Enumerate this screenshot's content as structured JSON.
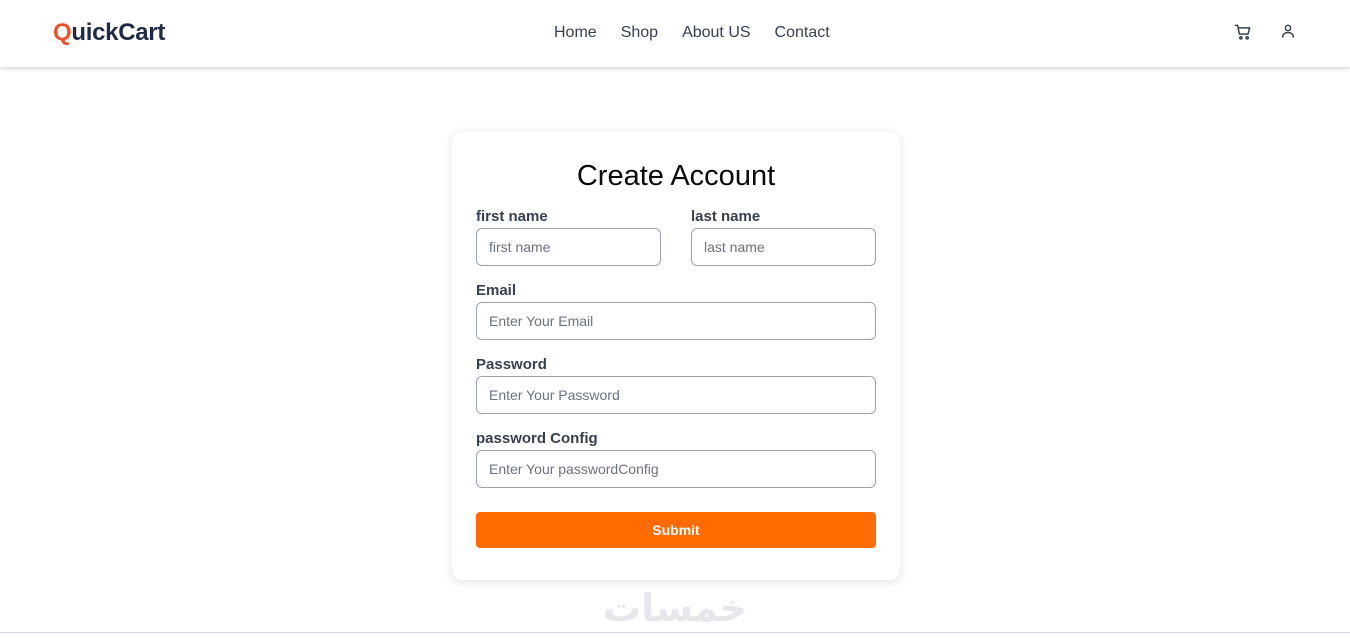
{
  "brand": {
    "first_letter": "Q",
    "rest": "uickCart",
    "accent_color": "#f0512a"
  },
  "nav": {
    "links": [
      {
        "label": "Home"
      },
      {
        "label": "Shop"
      },
      {
        "label": "About US"
      },
      {
        "label": "Contact"
      }
    ],
    "icons": [
      "cart-icon",
      "user-icon"
    ]
  },
  "form": {
    "title": "Create Account",
    "first_name": {
      "label": "first name",
      "placeholder": "first name",
      "value": ""
    },
    "last_name": {
      "label": "last name",
      "placeholder": "last name",
      "value": ""
    },
    "email": {
      "label": "Email",
      "placeholder": "Enter Your Email",
      "value": ""
    },
    "password": {
      "label": "Password",
      "placeholder": "Enter Your Password",
      "value": ""
    },
    "password_config": {
      "label": "password Config",
      "placeholder": "Enter Your passwordConfig",
      "value": ""
    },
    "submit_label": "Submit",
    "submit_color": "#ff6b00"
  },
  "watermark": {
    "text": "خمسات"
  }
}
